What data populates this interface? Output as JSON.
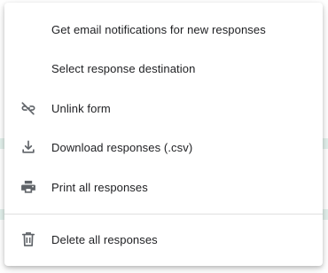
{
  "menu": {
    "items": [
      {
        "label": "Get email notifications for new responses",
        "icon": null
      },
      {
        "label": "Select response destination",
        "icon": null
      },
      {
        "label": "Unlink form",
        "icon": "unlink-icon"
      },
      {
        "label": "Download responses (.csv)",
        "icon": "download-icon"
      },
      {
        "label": "Print all responses",
        "icon": "print-icon"
      },
      {
        "label": "Delete all responses",
        "icon": "trash-icon"
      }
    ]
  }
}
